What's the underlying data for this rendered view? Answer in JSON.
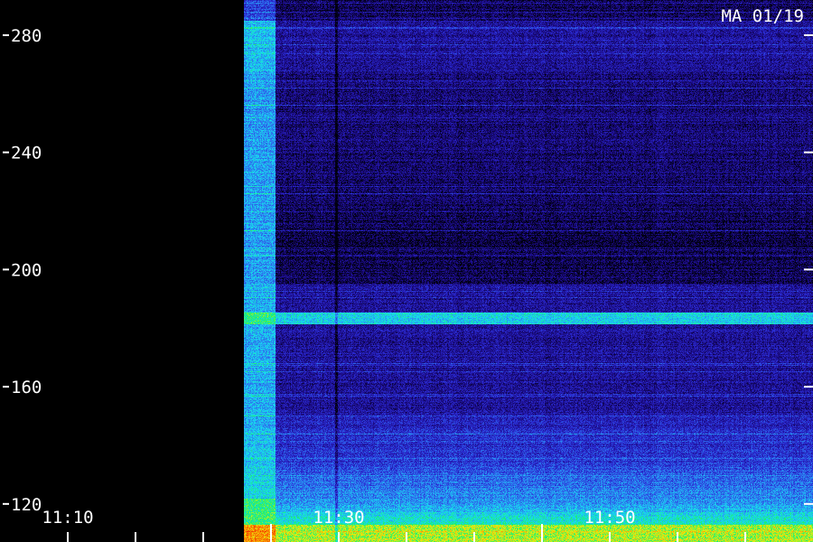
{
  "chart_data": {
    "type": "heatmap",
    "stamp": "MA 01/19",
    "y_ticks": [
      120,
      160,
      200,
      240,
      280
    ],
    "x_major_ticks": [
      "11:10",
      "11:30",
      "11:50"
    ],
    "ylim": [
      107,
      292
    ],
    "xlim_minutes": [
      0,
      60
    ],
    "x_minor_tick_step_min": 5,
    "data_gap": {
      "start_min": 0,
      "end_min": 18
    },
    "bright_bands": [
      {
        "from": 107,
        "to": 113,
        "level": "high"
      },
      {
        "from": 113,
        "to": 122,
        "level": "elevated"
      },
      {
        "from": 181.5,
        "to": 185.5,
        "level": "elevated"
      }
    ],
    "colormap": [
      "#000010",
      "#1a0a80",
      "#2a2ad0",
      "#2c7cf0",
      "#18d8f0",
      "#1cf070",
      "#e0f010",
      "#ff8000",
      "#e01000"
    ]
  }
}
